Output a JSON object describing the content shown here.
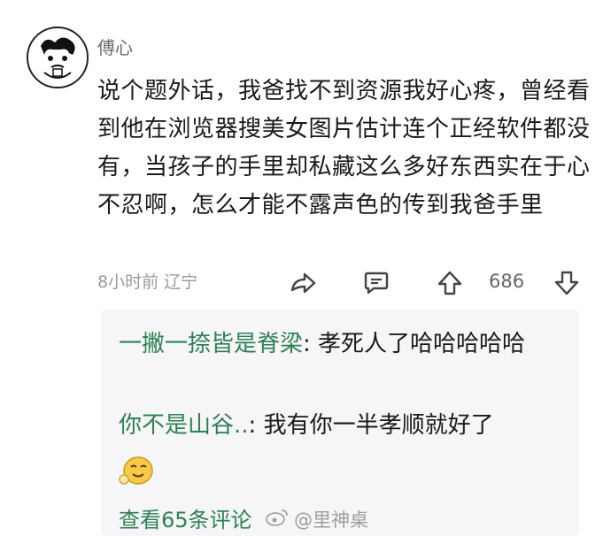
{
  "post": {
    "username": "傅心",
    "content": "说个题外话，我爸找不到资源我好心疼，曾经看到他在浏览器搜美女图片估计连个正经软件都没有，当孩子的手里却私藏这么多好东西实在于心不忍啊，怎么才能不露声色的传到我爸手里",
    "time": "8小时前",
    "location": "辽宁",
    "like_count": "686"
  },
  "icons": {
    "share": "share-icon",
    "comment": "comment-icon",
    "upvote": "upvote-icon",
    "downvote": "downvote-icon"
  },
  "replies": [
    {
      "name": "一撇一捺皆是脊梁",
      "separator": ": ",
      "text": "孝死人了哈哈哈哈哈"
    },
    {
      "name": "你不是山谷..",
      "separator": ": ",
      "text": "我有你一半孝顺就好了"
    }
  ],
  "view_more": "查看65条评论",
  "watermark": "@里神桌",
  "colors": {
    "accent_green": "#2f7f55",
    "meta_gray": "#9a9a9a",
    "reply_bg": "#f6f6f8"
  }
}
